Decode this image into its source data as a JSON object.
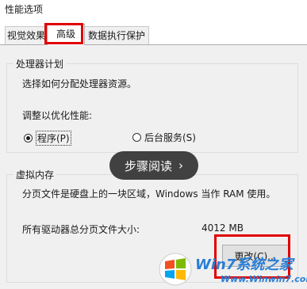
{
  "window": {
    "title": "性能选项"
  },
  "tabs": [
    {
      "label": "视觉效果"
    },
    {
      "label": "高级"
    },
    {
      "label": "数据执行保护"
    }
  ],
  "processor": {
    "title": "处理器计划",
    "desc": "选择如何分配处理器资源。",
    "adjust_label": "调整以优化性能:",
    "options": [
      {
        "label": "程序(P)",
        "selected": true
      },
      {
        "label": "后台服务(S)",
        "selected": false
      }
    ]
  },
  "virtual_memory": {
    "title": "虚拟内存",
    "desc": "分页文件是硬盘上的一块区域，Windows 当作 RAM 使用。",
    "total_label": "所有驱动器总分页文件大小:",
    "total_value": "4012 MB",
    "change_button": "更改(C)..."
  },
  "overlay": {
    "label": "步骤阅读"
  },
  "watermark": {
    "line1": "Win7系统之家",
    "line2": "Www.Winwin7.com"
  },
  "colors": {
    "highlight": "#e00000",
    "panel": "#f0f0f0"
  }
}
